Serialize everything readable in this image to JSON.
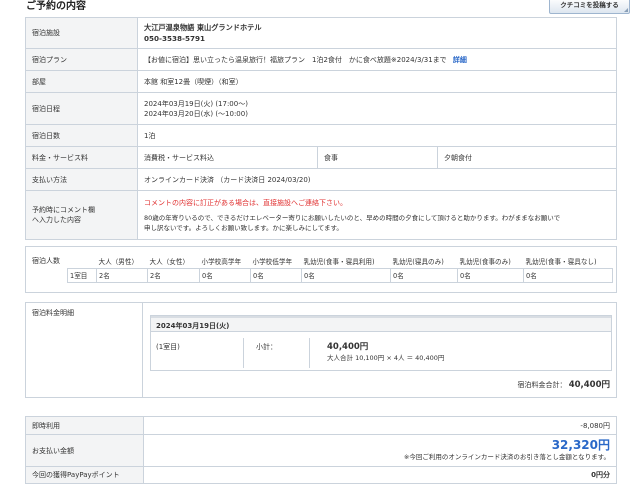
{
  "header": {
    "title": "ご予約の内容",
    "review_button": "クチコミを投稿する"
  },
  "details": {
    "facility_label": "宿泊施設",
    "facility_name": "大江戸温泉物語 東山グランドホテル",
    "facility_phone": "050-3538-5791",
    "plan_label": "宿泊プラン",
    "plan_text": "【お値に宿泊】思い立ったら温泉旅行！福旅プラン　1泊2食付　かに食べ放題※2024/3/31まで",
    "plan_detail_link": "詳細",
    "room_label": "部屋",
    "room_text": "本館 和室12畳（喫煙）（和室）",
    "dates_label": "宿泊日程",
    "checkin": "2024年03月19日(火) (17:00〜)",
    "checkout": "2024年03月20日(水) (〜10:00)",
    "nights_label": "宿泊日数",
    "nights": "1泊",
    "fees_label": "料金・サービス料",
    "fees_text": "消費税・サービス料込",
    "meal_label": "食事",
    "meal_value": "夕朝食付",
    "payment_label": "支払い方法",
    "payment_text": "オンラインカード決済 （カード決済日 2024/03/20)",
    "comment_label_1": "予約時にコメント欄",
    "comment_label_2": "へ入力した内容",
    "comment_warning": "コメントの内容に訂正がある場合は、直接施設へご連絡下さい。",
    "comment_line1": "80歳の年寄りいるので、できるだけエレベーター寄りにお願いしたいのと、早めの時間の夕食にして頂けると助かります。わがままなお願いで",
    "comment_line2": "申し訳ないです。よろしくお願い致します。かに楽しみにしてます。"
  },
  "guests": {
    "label": "宿泊人数",
    "headers": [
      "大人（男性）",
      "大人（女性）",
      "小学校高学年",
      "小学校低学年",
      "乳幼児(食事・寝具利用)",
      "乳幼児(寝具のみ)",
      "乳幼児(食事のみ)",
      "乳幼児(食事・寝具なし)"
    ],
    "row_label": "1室目",
    "values": [
      "2名",
      "2名",
      "0名",
      "0名",
      "0名",
      "0名",
      "0名",
      "0名"
    ]
  },
  "breakdown": {
    "label": "宿泊料金明細",
    "date": "2024年03月19日(火)",
    "room": "(1室目)",
    "subtotal_label": "小計：",
    "subtotal_amount": "40,400円",
    "subtotal_detail": "大人合計 10,100円 × 4人 ＝ 40,400円",
    "total_label": "宿泊料金合計：",
    "total_amount": "40,400円"
  },
  "payment": {
    "instant_label": "即時利用",
    "instant_value": "-8,080円",
    "amount_label": "お支払い金額",
    "amount_value": "32,320円",
    "amount_note": "※今回ご利用のオンラインカード決済のお引き落とし金額となります。",
    "points_label": "今回の獲得PayPayポイント",
    "points_value": "0円分"
  },
  "colors": {
    "accent": "#2a68c8",
    "warning": "#e03030",
    "label_bg": "#f3f4f5",
    "border": "#cbd3dc"
  }
}
